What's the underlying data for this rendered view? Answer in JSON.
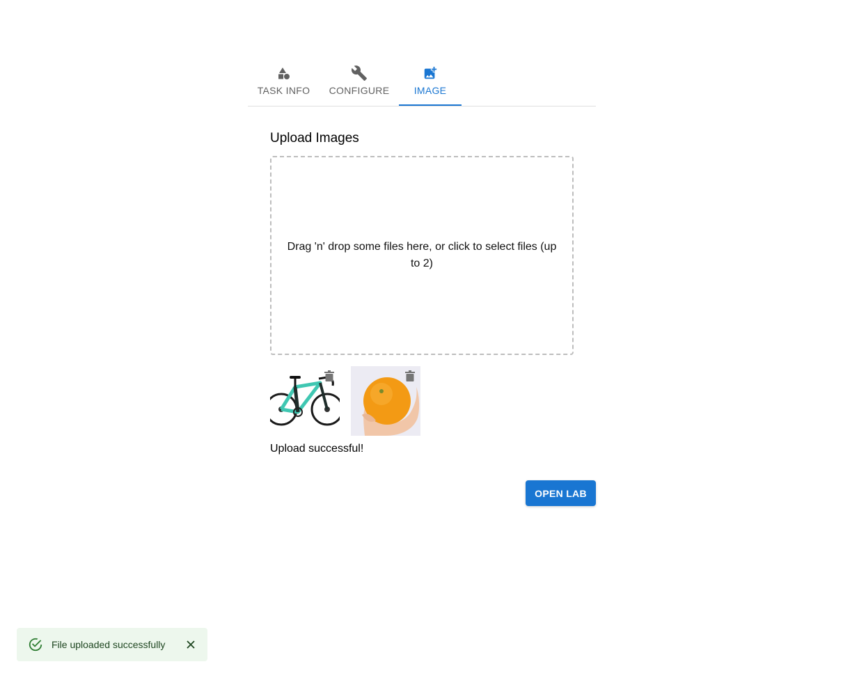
{
  "tabs": [
    {
      "label": "TASK INFO",
      "icon": "shapes-icon",
      "active": false
    },
    {
      "label": "CONFIGURE",
      "icon": "wrench-icon",
      "active": false
    },
    {
      "label": "IMAGE",
      "icon": "add-photo-icon",
      "active": true
    }
  ],
  "upload": {
    "title": "Upload Images",
    "dropzone_text": "Drag 'n' drop some files here, or click to select files (up to 2)"
  },
  "thumbnails": [
    {
      "subject": "bicycle",
      "delete_icon": "trash-icon"
    },
    {
      "subject": "orange-in-hand",
      "delete_icon": "trash-icon"
    }
  ],
  "status": {
    "text": "Upload successful!"
  },
  "actions": {
    "open_lab_label": "OPEN LAB"
  },
  "snackbar": {
    "message": "File uploaded successfully",
    "icon": "check-circle-icon",
    "close_icon": "close-icon"
  },
  "colors": {
    "primary": "#1976d2",
    "tab_inactive": "#616161",
    "snackbar_bg": "#edf7ed",
    "snackbar_text": "#1e4620",
    "success_icon": "#2e7d32"
  }
}
